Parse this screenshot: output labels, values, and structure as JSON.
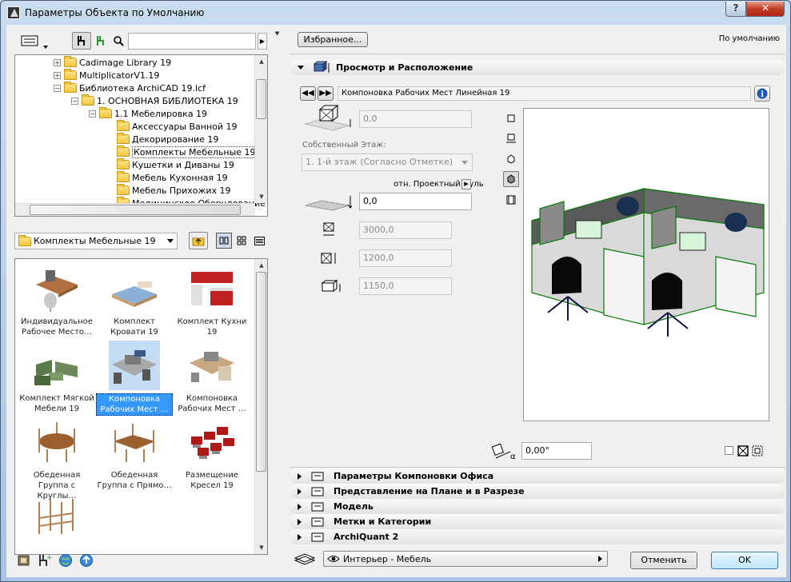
{
  "window": {
    "title": "Параметры Объекта по Умолчанию",
    "help": "?",
    "close": "✕"
  },
  "left": {
    "tree": [
      {
        "label": "Cadimage Library 19",
        "indent": 0
      },
      {
        "label": "MultiplicatorV1.19",
        "indent": 0
      },
      {
        "label": "Библиотека ArchiCAD 19.lcf",
        "indent": 0
      },
      {
        "label": "1. ОСНОВНАЯ БИБЛИОТЕКА 19",
        "indent": 1
      },
      {
        "label": "1.1 Мебелировка 19",
        "indent": 2
      },
      {
        "label": "Аксессуары Ванной 19",
        "indent": 3
      },
      {
        "label": "Декорирование 19",
        "indent": 3
      },
      {
        "label": "Комплекты Мебельные 19",
        "indent": 3,
        "selected": true
      },
      {
        "label": "Кушетки и Диваны 19",
        "indent": 3
      },
      {
        "label": "Мебель Кухонная 19",
        "indent": 3
      },
      {
        "label": "Мебель Прихожих 19",
        "indent": 3
      },
      {
        "label": "Медицинское Оборудование",
        "indent": 3
      }
    ],
    "folder_combo": "Комплекты Мебельные 19",
    "items": [
      {
        "label": "Индивидуальное Рабочее Место…"
      },
      {
        "label": "Комплект Кровати 19"
      },
      {
        "label": "Комплект Кухни 19"
      },
      {
        "label": "Комплект Мягкой Мебели 19"
      },
      {
        "label": "Компоновка Рабочих Мест …",
        "selected": true
      },
      {
        "label": "Компоновка Рабочих Мест …"
      },
      {
        "label": "Обеденная Группа с Круглы…"
      },
      {
        "label": "Обеденная Группа с Прямо…"
      },
      {
        "label": "Размещение Кресел 19"
      },
      {
        "label": ""
      }
    ]
  },
  "right": {
    "favorites": "Избранное...",
    "default_label": "По умолчанию",
    "section_title": "Просмотр и Расположение",
    "object_name": "Компоновка Рабочих Мест Линейная 19",
    "elev_value": "0,0",
    "story_label": "Собственный Этаж:",
    "story_value": "1. 1-й этаж (Согласно Отметке)",
    "ref_label": "отн. Проектный Нуль",
    "ref_value": "0,0",
    "dim_a": "3000,0",
    "dim_b": "1200,0",
    "dim_c": "1150,0",
    "angle": "0,00°",
    "sections": [
      "Параметры Компоновки Офиса",
      "Представление на Плане и в Разрезе",
      "Модель",
      "Метки и Категории",
      "ArchiQuant 2"
    ],
    "layer": "Интерьер - Мебель",
    "cancel": "Отменить",
    "ok": "OK"
  }
}
